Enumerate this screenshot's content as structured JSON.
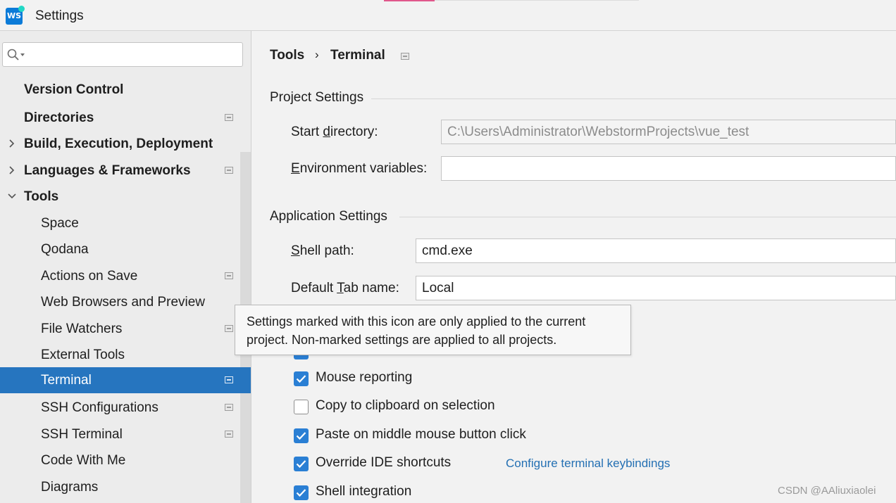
{
  "window": {
    "title": "Settings",
    "logo_text": "WS"
  },
  "sidebar": {
    "search": {
      "value": "",
      "placeholder": ""
    },
    "items": [
      {
        "label": "Version Control",
        "bold": true,
        "expander": "none",
        "project_icon": false,
        "selected": false
      },
      {
        "label": "Directories",
        "bold": true,
        "expander": "none",
        "project_icon": true,
        "selected": false
      },
      {
        "label": "Build, Execution, Deployment",
        "bold": true,
        "expander": "collapsed",
        "project_icon": false,
        "selected": false
      },
      {
        "label": "Languages & Frameworks",
        "bold": true,
        "expander": "collapsed",
        "project_icon": true,
        "selected": false
      },
      {
        "label": "Tools",
        "bold": true,
        "expander": "expanded",
        "project_icon": false,
        "selected": false
      },
      {
        "label": "Space",
        "bold": false,
        "expander": "none",
        "project_icon": false,
        "selected": false
      },
      {
        "label": "Qodana",
        "bold": false,
        "expander": "none",
        "project_icon": false,
        "selected": false
      },
      {
        "label": "Actions on Save",
        "bold": false,
        "expander": "none",
        "project_icon": true,
        "selected": false
      },
      {
        "label": "Web Browsers and Preview",
        "bold": false,
        "expander": "none",
        "project_icon": false,
        "selected": false
      },
      {
        "label": "File Watchers",
        "bold": false,
        "expander": "none",
        "project_icon": true,
        "selected": false
      },
      {
        "label": "External Tools",
        "bold": false,
        "expander": "none",
        "project_icon": false,
        "selected": false
      },
      {
        "label": "Terminal",
        "bold": false,
        "expander": "none",
        "project_icon": true,
        "selected": true
      },
      {
        "label": "SSH Configurations",
        "bold": false,
        "expander": "none",
        "project_icon": true,
        "selected": false
      },
      {
        "label": "SSH Terminal",
        "bold": false,
        "expander": "none",
        "project_icon": true,
        "selected": false
      },
      {
        "label": "Code With Me",
        "bold": false,
        "expander": "none",
        "project_icon": false,
        "selected": false
      },
      {
        "label": "Diagrams",
        "bold": false,
        "expander": "none",
        "project_icon": false,
        "selected": false
      }
    ]
  },
  "breadcrumb": {
    "parent": "Tools",
    "separator": "›",
    "current": "Terminal"
  },
  "project_settings": {
    "title": "Project Settings",
    "start_directory": {
      "label_pre": "Start ",
      "label_mnemonic": "d",
      "label_post": "irectory:",
      "value": "C:\\Users\\Administrator\\WebstormProjects\\vue_test"
    },
    "env_vars": {
      "label_pre": "",
      "label_mnemonic": "E",
      "label_post": "nvironment variables:",
      "value": ""
    }
  },
  "application_settings": {
    "title": "Application Settings",
    "shell_path": {
      "label_pre": "",
      "label_mnemonic": "S",
      "label_post": "hell path:",
      "value": "cmd.exe"
    },
    "tab_name": {
      "label_pre": "Default ",
      "label_mnemonic": "T",
      "label_post": "ab name:",
      "value": "Local"
    }
  },
  "checkboxes": [
    {
      "label": "Mouse reporting",
      "checked": true
    },
    {
      "label": "Copy to clipboard on selection",
      "checked": false
    },
    {
      "label": "Paste on middle mouse button click",
      "checked": true
    },
    {
      "label": "Override IDE shortcuts",
      "checked": true,
      "link": "Configure terminal keybindings"
    },
    {
      "label": "Shell integration",
      "checked": true
    }
  ],
  "tooltip": {
    "line1": "Settings marked with this icon are only applied to the current",
    "line2": "project. Non-marked settings are applied to all projects."
  },
  "watermark": "CSDN @AAliuxiaolei",
  "colors": {
    "selection": "#2675bf",
    "checkbox": "#2a7fd4",
    "link": "#2470b3",
    "accent": "#e0578b"
  }
}
